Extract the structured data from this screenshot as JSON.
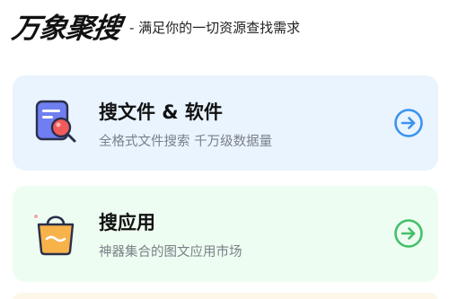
{
  "header": {
    "brand": "万象聚搜",
    "tagline": "- 满足你的一切资源查找需求"
  },
  "cards": [
    {
      "title": "搜文件 & 软件",
      "subtitle": "全格式文件搜索 千万级数据量",
      "icon": "document-search-icon",
      "arrow_icon": "arrow-right-circle-icon",
      "background": "#e9f4fe",
      "accent": "#3b93f0"
    },
    {
      "title": "搜应用",
      "subtitle": "神器集合的图文应用市场",
      "icon": "shopping-bag-icon",
      "arrow_icon": "arrow-right-circle-icon",
      "background": "#eefdf1",
      "accent": "#43c06a"
    }
  ]
}
